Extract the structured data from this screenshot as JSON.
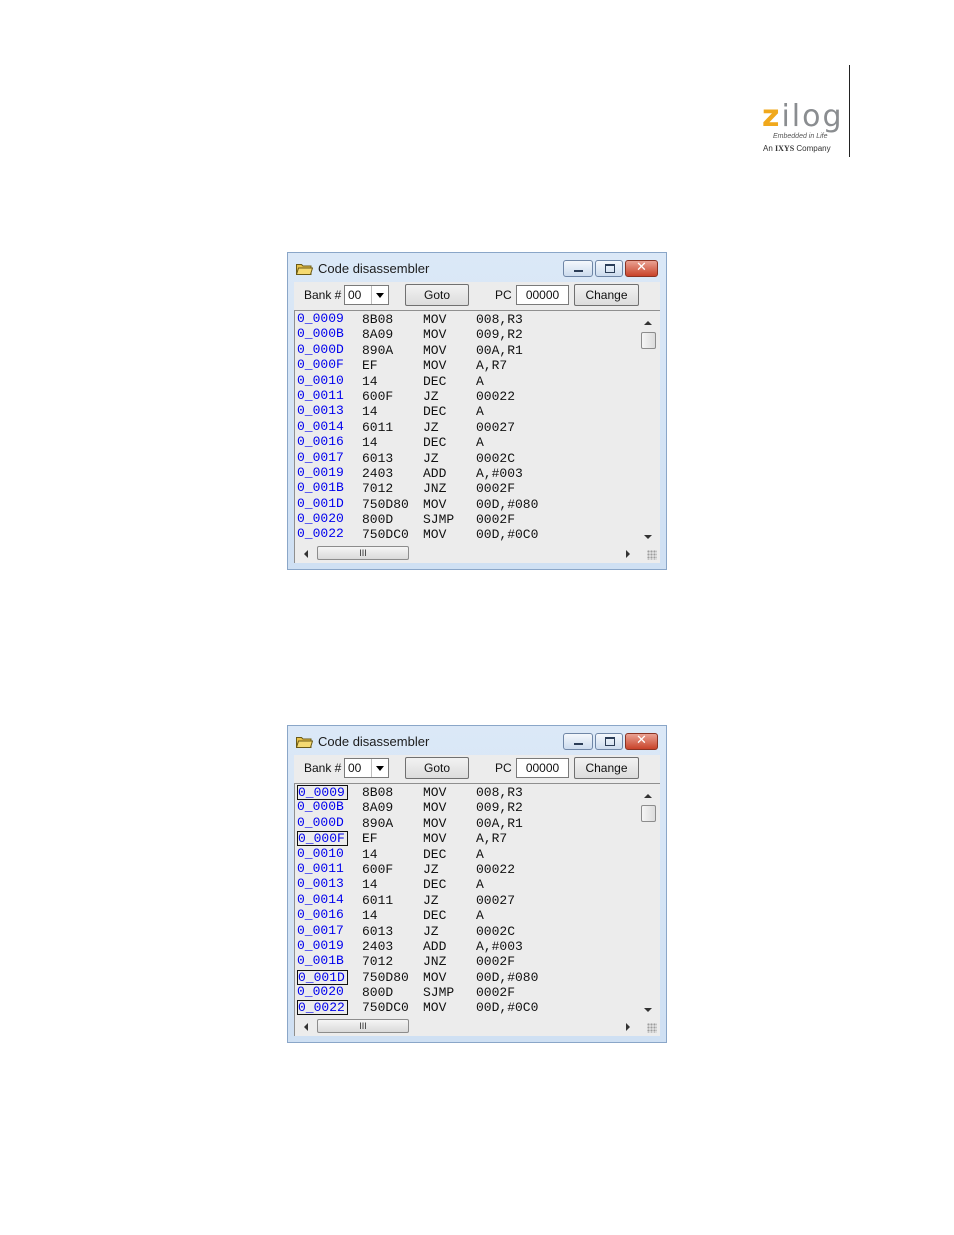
{
  "logo": {
    "wordmark": "zilog",
    "tagline": "Embedded in Life",
    "company_prefix": "An",
    "company_name": "IXYS",
    "company_suffix": "Company",
    "colors": {
      "z": "#f0a81c",
      "ilog": "#8a8d90"
    }
  },
  "windows": [
    {
      "title": "Code disassembler",
      "bank_label": "Bank #",
      "bank_value": "00",
      "goto_label": "Goto",
      "pc_label": "PC",
      "pc_value": "00000",
      "change_label": "Change",
      "hscroll_thumb": "III",
      "rows": [
        {
          "addr": "0_0009",
          "code": "8B08",
          "op": "MOV",
          "arg": "008,R3",
          "boxed": false
        },
        {
          "addr": "0_000B",
          "code": "8A09",
          "op": "MOV",
          "arg": "009,R2",
          "boxed": false
        },
        {
          "addr": "0_000D",
          "code": "890A",
          "op": "MOV",
          "arg": "00A,R1",
          "boxed": false
        },
        {
          "addr": "0_000F",
          "code": "EF",
          "op": "MOV",
          "arg": "A,R7",
          "boxed": false
        },
        {
          "addr": "0_0010",
          "code": "14",
          "op": "DEC",
          "arg": "A",
          "boxed": false
        },
        {
          "addr": "0_0011",
          "code": "600F",
          "op": "JZ",
          "arg": "00022",
          "boxed": false
        },
        {
          "addr": "0_0013",
          "code": "14",
          "op": "DEC",
          "arg": "A",
          "boxed": false
        },
        {
          "addr": "0_0014",
          "code": "6011",
          "op": "JZ",
          "arg": "00027",
          "boxed": false
        },
        {
          "addr": "0_0016",
          "code": "14",
          "op": "DEC",
          "arg": "A",
          "boxed": false
        },
        {
          "addr": "0_0017",
          "code": "6013",
          "op": "JZ",
          "arg": "0002C",
          "boxed": false
        },
        {
          "addr": "0_0019",
          "code": "2403",
          "op": "ADD",
          "arg": "A,#003",
          "boxed": false
        },
        {
          "addr": "0_001B",
          "code": "7012",
          "op": "JNZ",
          "arg": "0002F",
          "boxed": false
        },
        {
          "addr": "0_001D",
          "code": "750D80",
          "op": "MOV",
          "arg": "00D,#080",
          "boxed": false
        },
        {
          "addr": "0_0020",
          "code": "800D",
          "op": "SJMP",
          "arg": "0002F",
          "boxed": false
        },
        {
          "addr": "0_0022",
          "code": "750DC0",
          "op": "MOV",
          "arg": "00D,#0C0",
          "boxed": false
        }
      ]
    },
    {
      "title": "Code disassembler",
      "bank_label": "Bank #",
      "bank_value": "00",
      "goto_label": "Goto",
      "pc_label": "PC",
      "pc_value": "00000",
      "change_label": "Change",
      "hscroll_thumb": "III",
      "rows": [
        {
          "addr": "0_0009",
          "code": "8B08",
          "op": "MOV",
          "arg": "008,R3",
          "boxed": true
        },
        {
          "addr": "0_000B",
          "code": "8A09",
          "op": "MOV",
          "arg": "009,R2",
          "boxed": false
        },
        {
          "addr": "0_000D",
          "code": "890A",
          "op": "MOV",
          "arg": "00A,R1",
          "boxed": false
        },
        {
          "addr": "0_000F",
          "code": "EF",
          "op": "MOV",
          "arg": "A,R7",
          "boxed": true
        },
        {
          "addr": "0_0010",
          "code": "14",
          "op": "DEC",
          "arg": "A",
          "boxed": false
        },
        {
          "addr": "0_0011",
          "code": "600F",
          "op": "JZ",
          "arg": "00022",
          "boxed": false
        },
        {
          "addr": "0_0013",
          "code": "14",
          "op": "DEC",
          "arg": "A",
          "boxed": false
        },
        {
          "addr": "0_0014",
          "code": "6011",
          "op": "JZ",
          "arg": "00027",
          "boxed": false
        },
        {
          "addr": "0_0016",
          "code": "14",
          "op": "DEC",
          "arg": "A",
          "boxed": false
        },
        {
          "addr": "0_0017",
          "code": "6013",
          "op": "JZ",
          "arg": "0002C",
          "boxed": false
        },
        {
          "addr": "0_0019",
          "code": "2403",
          "op": "ADD",
          "arg": "A,#003",
          "boxed": false
        },
        {
          "addr": "0_001B",
          "code": "7012",
          "op": "JNZ",
          "arg": "0002F",
          "boxed": false
        },
        {
          "addr": "0_001D",
          "code": "750D80",
          "op": "MOV",
          "arg": "00D,#080",
          "boxed": true
        },
        {
          "addr": "0_0020",
          "code": "800D",
          "op": "SJMP",
          "arg": "0002F",
          "boxed": false
        },
        {
          "addr": "0_0022",
          "code": "750DC0",
          "op": "MOV",
          "arg": "00D,#0C0",
          "boxed": true
        }
      ]
    }
  ]
}
